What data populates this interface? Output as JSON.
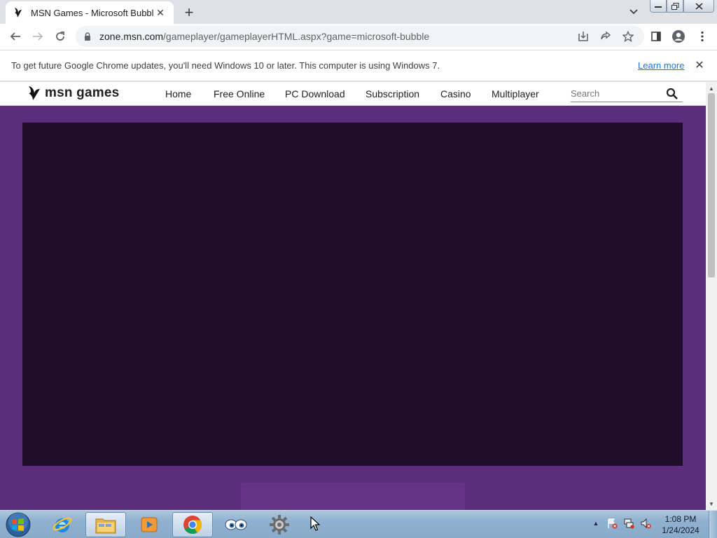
{
  "browser": {
    "tab_title": "MSN Games - Microsoft Bubble",
    "url_host": "zone.msn.com",
    "url_path": "/gameplayer/gameplayerHTML.aspx?game=microsoft-bubble"
  },
  "infobar": {
    "message": "To get future Google Chrome updates, you'll need Windows 10 or later. This computer is using Windows 7.",
    "link": "Learn more"
  },
  "site": {
    "brand": "msn games",
    "nav": [
      "Home",
      "Free Online",
      "PC Download",
      "Subscription",
      "Casino",
      "Multiplayer"
    ],
    "search_placeholder": "Search"
  },
  "taskbar": {
    "time": "1:08 PM",
    "date": "1/24/2024",
    "pinned": [
      "internet-explorer-icon",
      "file-explorer-icon",
      "media-player-icon",
      "chrome-icon",
      "eyes-app-icon",
      "gear-app-icon"
    ]
  },
  "colors": {
    "page_bg": "#5c2d7a",
    "game_area": "#1e0d2b",
    "link": "#1a73e8"
  }
}
